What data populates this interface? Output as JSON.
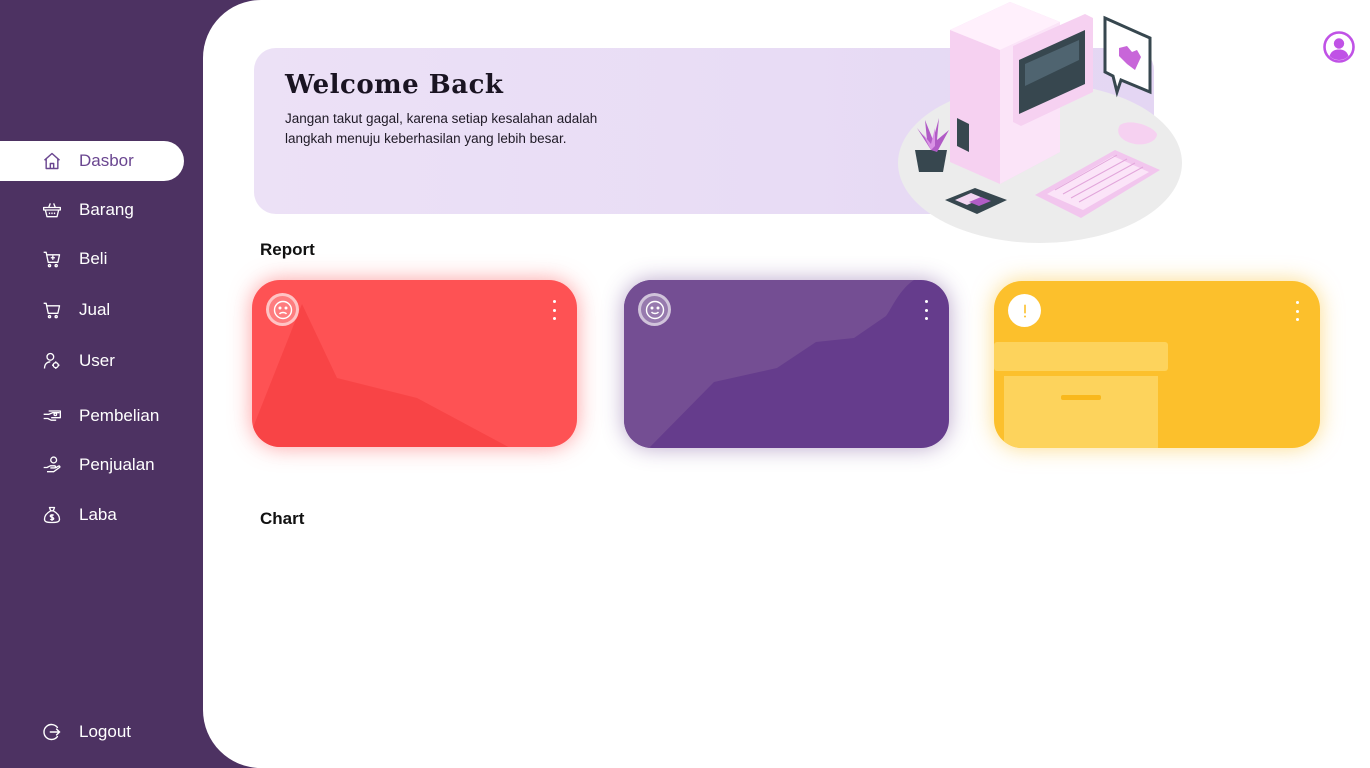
{
  "sidebar": {
    "items": [
      {
        "label": "Dasbor",
        "icon": "home-icon",
        "active": true
      },
      {
        "label": "Barang",
        "icon": "basket-icon"
      },
      {
        "label": "Beli",
        "icon": "cart-plus-icon"
      },
      {
        "label": "Jual",
        "icon": "cart-icon"
      },
      {
        "label": "User",
        "icon": "user-gear-icon"
      },
      {
        "label": "Pembelian",
        "icon": "hand-money-icon"
      },
      {
        "label": "Penjualan",
        "icon": "hand-give-icon"
      },
      {
        "label": "Laba",
        "icon": "money-bag-icon"
      }
    ],
    "logout": {
      "label": "Logout",
      "icon": "logout-icon"
    }
  },
  "welcome": {
    "title": "Welcome Back",
    "text": "Jangan takut gagal, karena setiap kesalahan adalah langkah menuju keberhasilan yang lebih besar."
  },
  "report": {
    "title": "Report",
    "cards": [
      {
        "color": "#fe5254",
        "icon": "sad-face-icon"
      },
      {
        "color": "#653c8c",
        "icon": "smile-face-icon"
      },
      {
        "color": "#fcc02c",
        "icon": "exclamation-icon"
      }
    ]
  },
  "chart": {
    "title": "Chart"
  },
  "colors": {
    "sidebar": "#4d3262",
    "accent": "#6a4690",
    "banner": "#ece1f6",
    "avatar": "#c052e6"
  }
}
